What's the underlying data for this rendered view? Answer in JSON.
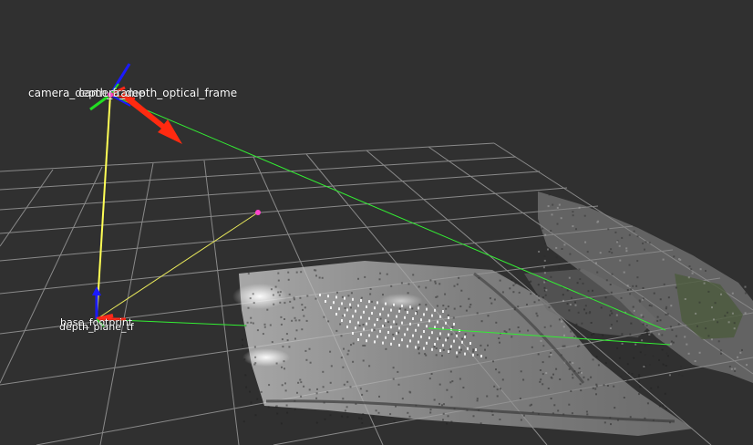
{
  "frames": {
    "camera_frame_label": "camera_depth_frame",
    "optical_frame_label": "camera_depth_optical_frame",
    "base_frame_label": "base_footprint",
    "plane_frame_label": "depth_plane_tf"
  },
  "colors": {
    "background": "#303030",
    "grid": "#a0a0a0",
    "axis_x": "#ff2a1a",
    "axis_y": "#22dd22",
    "axis_z": "#1a1aff",
    "tf_link_yellow": "#ffff55",
    "tf_link_green": "#33ee33",
    "pose_arrow": "#ff2a10",
    "marker_point": "#ff44cc",
    "cloud_grey": "#c8c8c8"
  },
  "icons": {
    "camera_axes": "axes-triad-icon",
    "pose_arrow": "arrow-icon",
    "marker": "point-marker-icon"
  }
}
